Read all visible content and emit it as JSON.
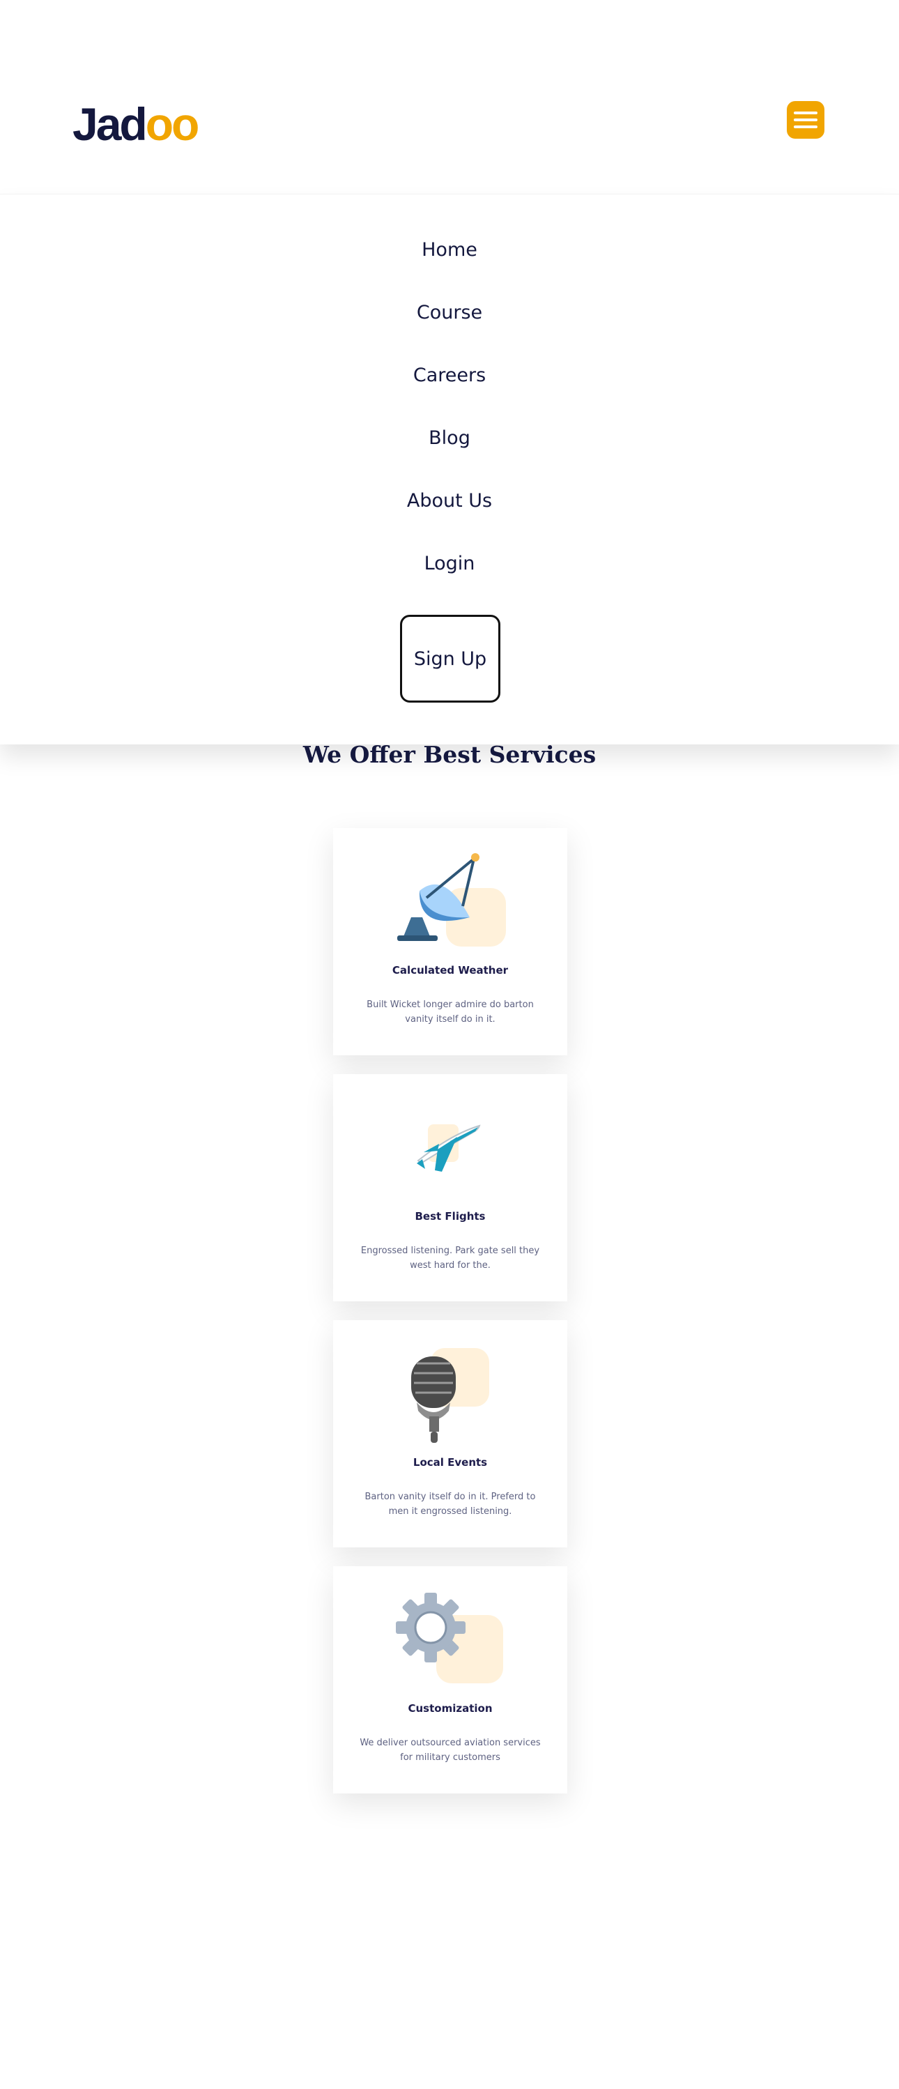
{
  "brand": {
    "logo_prefix": "Jad",
    "logo_suffix": "oo",
    "accent": "#f1a501",
    "text_color": "#14183e"
  },
  "nav": {
    "items": [
      "Home",
      "Course",
      "Careers",
      "Blog",
      "About Us",
      "Login"
    ],
    "signup_label": "Sign Up"
  },
  "services": {
    "title": "We Offer Best Services",
    "cards": [
      {
        "icon": "satellite-dish-icon",
        "title": "Calculated Weather",
        "text": "Built Wicket longer admire do barton vanity itself do in it."
      },
      {
        "icon": "airplane-icon",
        "title": "Best Flights",
        "text": "Engrossed listening. Park gate sell they west hard for the."
      },
      {
        "icon": "microphone-icon",
        "title": "Local Events",
        "text": "Barton vanity itself do in it. Preferd to men it engrossed listening."
      },
      {
        "icon": "gear-icon",
        "title": "Customization",
        "text": "We deliver outsourced aviation services for military customers"
      }
    ]
  }
}
